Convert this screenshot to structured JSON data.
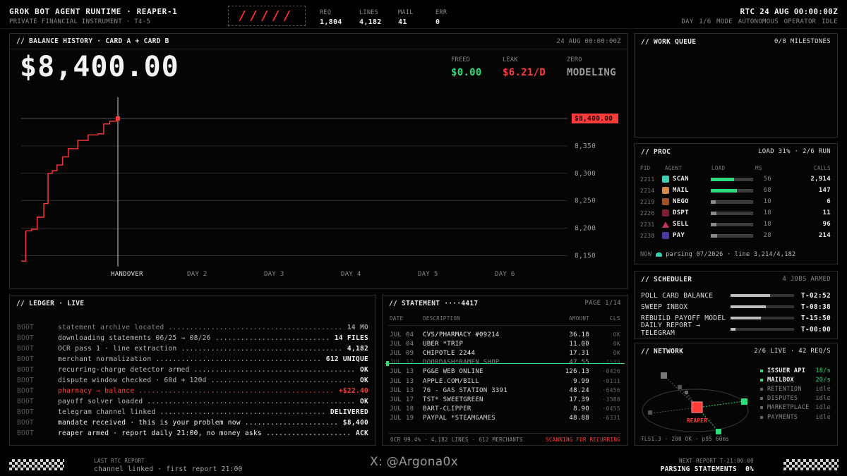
{
  "header": {
    "title": "GROK BOT AGENT RUNTIME · REAPER-1",
    "subtitle": "PRIVATE FINANCIAL INSTRUMENT · T4-5",
    "logo": "/////",
    "stats": [
      {
        "label": "REQ",
        "value": "1,804"
      },
      {
        "label": "LINES",
        "value": "4,182"
      },
      {
        "label": "MAIL",
        "value": "41"
      },
      {
        "label": "ERR",
        "value": "0"
      }
    ],
    "rtc": "RTC 24 AUG 00:00:00Z",
    "rtc_sub": "DAY 1/6  MODE AUTONOMOUS  OPERATOR IDLE"
  },
  "balance": {
    "title": "// BALANCE HISTORY · CARD A + CARD B",
    "timestamp": "24 AUG 00:00:00Z",
    "amount": "$8,400.00",
    "freed_label": "FREED",
    "freed": "$0.00",
    "leak_label": "LEAK",
    "leak": "$6.21/D",
    "zero_label": "ZERO",
    "zero": "MODELING",
    "current_tag": "$8,400.00"
  },
  "chart_data": {
    "type": "line",
    "categories": [
      "HANDOVER",
      "DAY 2",
      "DAY 3",
      "DAY 4",
      "DAY 5",
      "DAY 6"
    ],
    "ytick_labels": [
      "8,350",
      "8,300",
      "8,250",
      "8,200",
      "8,150"
    ],
    "yticks": [
      8350,
      8300,
      8250,
      8200,
      8150
    ],
    "ylim": [
      8130,
      8400
    ],
    "series_color": "#ff3b3b",
    "points": [
      [
        0,
        8140
      ],
      [
        0.1,
        8140
      ],
      [
        0.1,
        8195
      ],
      [
        0.22,
        8195
      ],
      [
        0.22,
        8198
      ],
      [
        0.34,
        8198
      ],
      [
        0.34,
        8220
      ],
      [
        0.48,
        8220
      ],
      [
        0.48,
        8245
      ],
      [
        0.57,
        8245
      ],
      [
        0.57,
        8300
      ],
      [
        0.66,
        8300
      ],
      [
        0.66,
        8305
      ],
      [
        0.76,
        8305
      ],
      [
        0.76,
        8315
      ],
      [
        0.88,
        8315
      ],
      [
        0.88,
        8330
      ],
      [
        1.0,
        8330
      ],
      [
        1.0,
        8345
      ],
      [
        1.2,
        8345
      ],
      [
        1.2,
        8360
      ],
      [
        1.42,
        8360
      ],
      [
        1.42,
        8370
      ],
      [
        1.63,
        8370
      ],
      [
        1.63,
        8372
      ],
      [
        1.75,
        8372
      ],
      [
        1.75,
        8390
      ],
      [
        1.88,
        8390
      ],
      [
        1.88,
        8395
      ],
      [
        2.05,
        8395
      ],
      [
        2.05,
        8400
      ]
    ],
    "handover_x": 2.05
  },
  "ledger": {
    "title": "// LEDGER · LIVE",
    "rows": [
      {
        "k": "BOOT",
        "m": "statement archive located",
        "v": "14 MO",
        "style": "dim"
      },
      {
        "k": "BOOT",
        "m": "downloading statements 06/25 → 08/26",
        "v": "14 FILES",
        "style": "norm"
      },
      {
        "k": "BOOT",
        "m": "OCR pass 1 · line extraction",
        "v": "4,182",
        "style": "norm"
      },
      {
        "k": "BOOT",
        "m": "merchant normalization",
        "v": "612 UNIQUE",
        "style": "norm"
      },
      {
        "k": "BOOT",
        "m": "recurring-charge detector armed",
        "v": "OK",
        "style": "norm"
      },
      {
        "k": "BOOT",
        "m": "dispute window checked · 60d + 120d",
        "v": "OK",
        "style": "norm"
      },
      {
        "k": "BOOT",
        "m": "pharmacy → balance",
        "v": "+$22.40",
        "style": "red"
      },
      {
        "k": "BOOT",
        "m": "payoff solver loaded",
        "v": "OK",
        "style": "norm"
      },
      {
        "k": "BOOT",
        "m": "telegram channel linked",
        "v": "DELIVERED",
        "style": "norm"
      },
      {
        "k": "BOOT",
        "m": "mandate received · this is your problem now",
        "v": "$8,400",
        "style": "bold"
      },
      {
        "k": "BOOT",
        "m": "reaper armed · report daily 21:00, no money asks",
        "v": "ACK",
        "style": "bold"
      }
    ]
  },
  "statement": {
    "title": "// STATEMENT ····4417",
    "page": "PAGE 1/14",
    "headers": {
      "date": "DATE",
      "desc": "DESCRIPTION",
      "amount": "AMOUNT",
      "cls": "CLS"
    },
    "rows": [
      {
        "d": "JUL 04",
        "s": "CVS/PHARMACY #09214",
        "a": "36.18",
        "c": "OK"
      },
      {
        "d": "JUL 04",
        "s": "UBER *TRIP",
        "a": "11.00",
        "c": "OK"
      },
      {
        "d": "JUL 09",
        "s": "CHIPOTLE 2244",
        "a": "17.31",
        "c": "OK"
      },
      {
        "d": "JUL 12",
        "s": "DOORDASH*RAMEN SHOP",
        "a": "47.55",
        "c": "·1589"
      },
      {
        "d": "JUL 13",
        "s": "PG&E WEB ONLINE",
        "a": "126.13",
        "c": "·0426"
      },
      {
        "d": "JUL 13",
        "s": "APPLE.COM/BILL",
        "a": "9.99",
        "c": "·0111"
      },
      {
        "d": "JUL 13",
        "s": "76 - GAS STATION 3391",
        "a": "48.24",
        "c": "·6456"
      },
      {
        "d": "JUL 17",
        "s": "TST* SWEETGREEN",
        "a": "17.39",
        "c": "·3388"
      },
      {
        "d": "JUL 18",
        "s": "BART-CLIPPER",
        "a": "8.90",
        "c": "·0455"
      },
      {
        "d": "JUL 19",
        "s": "PAYPAL *STEAMGAMES",
        "a": "48.88",
        "c": "·6331"
      }
    ],
    "footer_left": "OCR 99.4% · 4,182 LINES · 612 MERCHANTS",
    "footer_right": "SCANNING FOR RECURRING"
  },
  "work_queue": {
    "title": "// WORK QUEUE",
    "right": "0/8 MILESTONES"
  },
  "proc": {
    "title": "// PROC",
    "right": "LOAD 31%  ·  2/6 RUN",
    "headers": {
      "pid": "PID",
      "agent": "AGENT",
      "load": "LOAD",
      "ms": "MS",
      "calls": "CALLS"
    },
    "rows": [
      {
        "pid": "2211",
        "agent": "SCAN",
        "load": 0.55,
        "ms": "56",
        "calls": "2,914",
        "icon": "#3ecfb2",
        "bar": "#2ddb7a"
      },
      {
        "pid": "2214",
        "agent": "MAIL",
        "load": 0.62,
        "ms": "68",
        "calls": "147",
        "icon": "#d08a4a",
        "bar": "#2ddb7a"
      },
      {
        "pid": "2219",
        "agent": "NEGO",
        "load": 0.12,
        "ms": "10",
        "calls": "6",
        "icon": "#a0522d",
        "bar": "#8a8a8a"
      },
      {
        "pid": "2226",
        "agent": "DSPT",
        "load": 0.13,
        "ms": "18",
        "calls": "11",
        "icon": "#7a2030",
        "bar": "#8a8a8a"
      },
      {
        "pid": "2231",
        "agent": "SELL",
        "load": 0.14,
        "ms": "18",
        "calls": "96",
        "icon": "#c0306a",
        "bar": "#8a8a8a"
      },
      {
        "pid": "2238",
        "agent": "PAY",
        "load": 0.15,
        "ms": "28",
        "calls": "214",
        "icon": "#4a3aa0",
        "bar": "#8a8a8a"
      }
    ],
    "now_label": "NOW",
    "now_text": "parsing 07/2026 · line 3,214/4,182"
  },
  "scheduler": {
    "title": "// SCHEDULER",
    "right": "4 JOBS ARMED",
    "rows": [
      {
        "n": "POLL CARD BALANCE",
        "p": 0.62,
        "t": "T-02:52"
      },
      {
        "n": "SWEEP INBOX",
        "p": 0.55,
        "t": "T-08:38"
      },
      {
        "n": "REBUILD PAYOFF MODEL",
        "p": 0.48,
        "t": "T-15:50"
      },
      {
        "n": "DAILY REPORT → TELEGRAM",
        "p": 0.08,
        "t": "T-00:00"
      }
    ]
  },
  "network": {
    "title": "// NETWORK",
    "right": "2/6 LIVE  ·  42 REQ/S",
    "center_label": "REAPER",
    "footer": "TLS1.3 · 200 OK · p95 60ms",
    "rows": [
      {
        "n": "ISSUER API",
        "r": "18/s",
        "live": true
      },
      {
        "n": "MAILBOX",
        "r": "20/s",
        "live": true
      },
      {
        "n": "RETENTION",
        "r": "idle",
        "live": false
      },
      {
        "n": "DISPUTES",
        "r": "idle",
        "live": false
      },
      {
        "n": "MARKETPLACE",
        "r": "idle",
        "live": false
      },
      {
        "n": "PAYMENTS",
        "r": "idle",
        "live": false
      }
    ]
  },
  "footer": {
    "last_label": "LAST RTC REPORT",
    "last_text": "channel linked · first report 21:00",
    "watermark": "X: @Argona0x",
    "next_label": "NEXT REPORT T-21:00:00",
    "next_text": "PARSING STATEMENTS  0%"
  },
  "colors": {
    "accent": "#ff3b3b",
    "live": "#2ddb7a",
    "panel_border": "#2a2a2a"
  }
}
